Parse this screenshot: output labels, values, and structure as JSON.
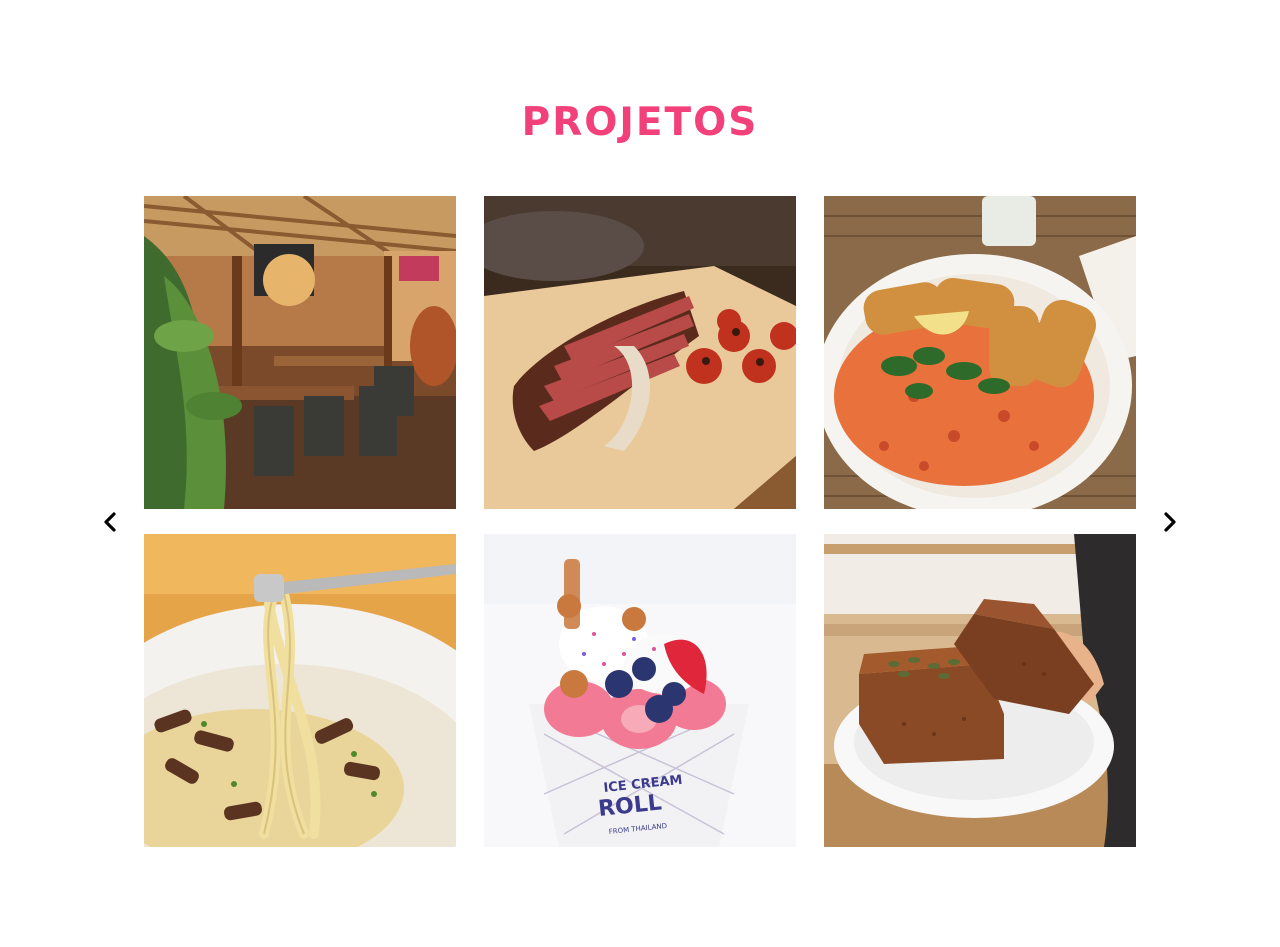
{
  "section": {
    "title": "PROJETOS",
    "accent_color": "#f2407a"
  },
  "carousel": {
    "prev_icon": "chevron-left-icon",
    "next_icon": "chevron-right-icon",
    "items": [
      {
        "name": "restaurant-terrace-photo"
      },
      {
        "name": "sliced-steak-tomatoes-photo"
      },
      {
        "name": "fried-fish-tomato-rice-photo"
      },
      {
        "name": "tagliatelle-mushrooms-photo"
      },
      {
        "name": "ice-cream-roll-cup-photo",
        "printed_text": "ICE CREAM ROLL FROM THAILAND"
      },
      {
        "name": "brown-bread-loaf-plate-photo"
      }
    ]
  }
}
